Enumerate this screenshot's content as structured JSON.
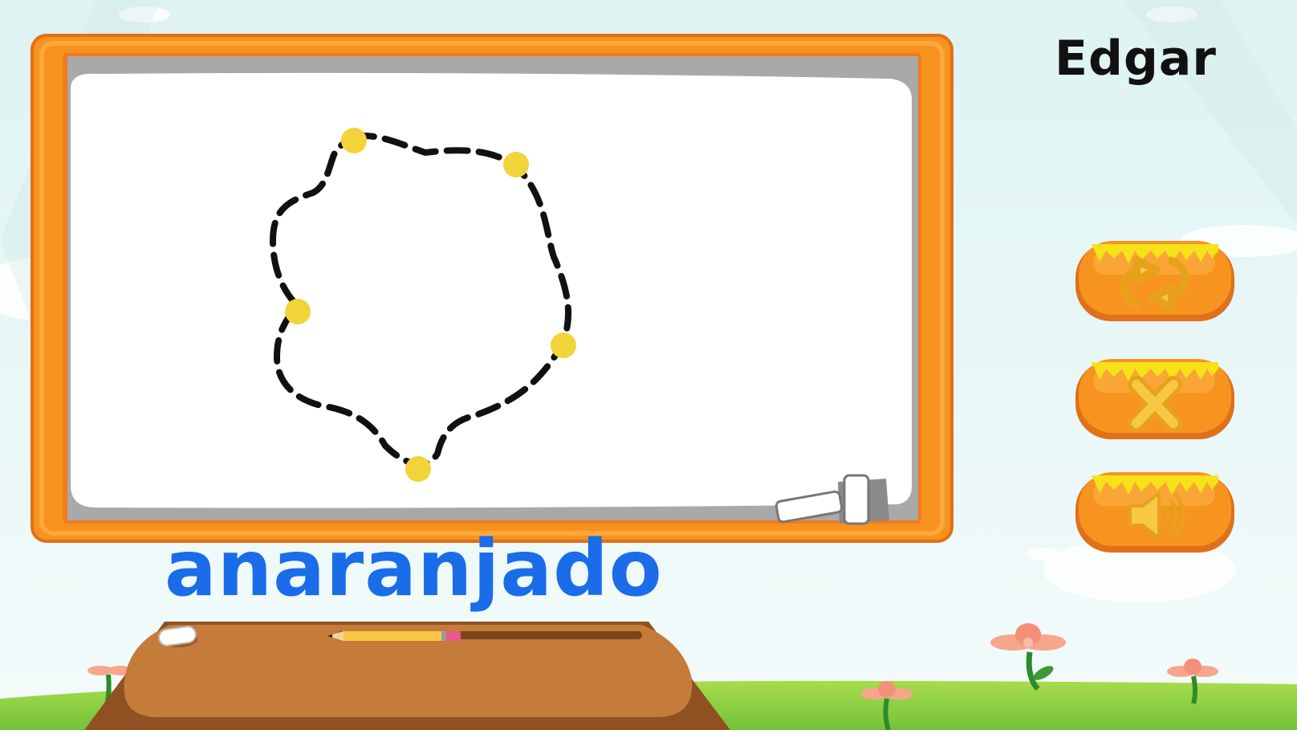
{
  "player": {
    "name": "Edgar"
  },
  "lesson": {
    "word": "anaranjado"
  },
  "colors": {
    "frame_orange": "#f7921e",
    "frame_dark": "#e0701a",
    "button_orange": "#f79420",
    "honey_yellow": "#f7e21a",
    "dot_yellow": "#f2d43a",
    "word_blue": "#1a6ce8",
    "table_brown": "#c57b3a"
  },
  "controls": {
    "redo": {
      "icon": "refresh-icon"
    },
    "clear": {
      "icon": "close-icon"
    },
    "sound": {
      "icon": "speaker-icon"
    }
  },
  "tools": {
    "eraser": "eraser-icon",
    "pencil": "pencil-icon"
  }
}
